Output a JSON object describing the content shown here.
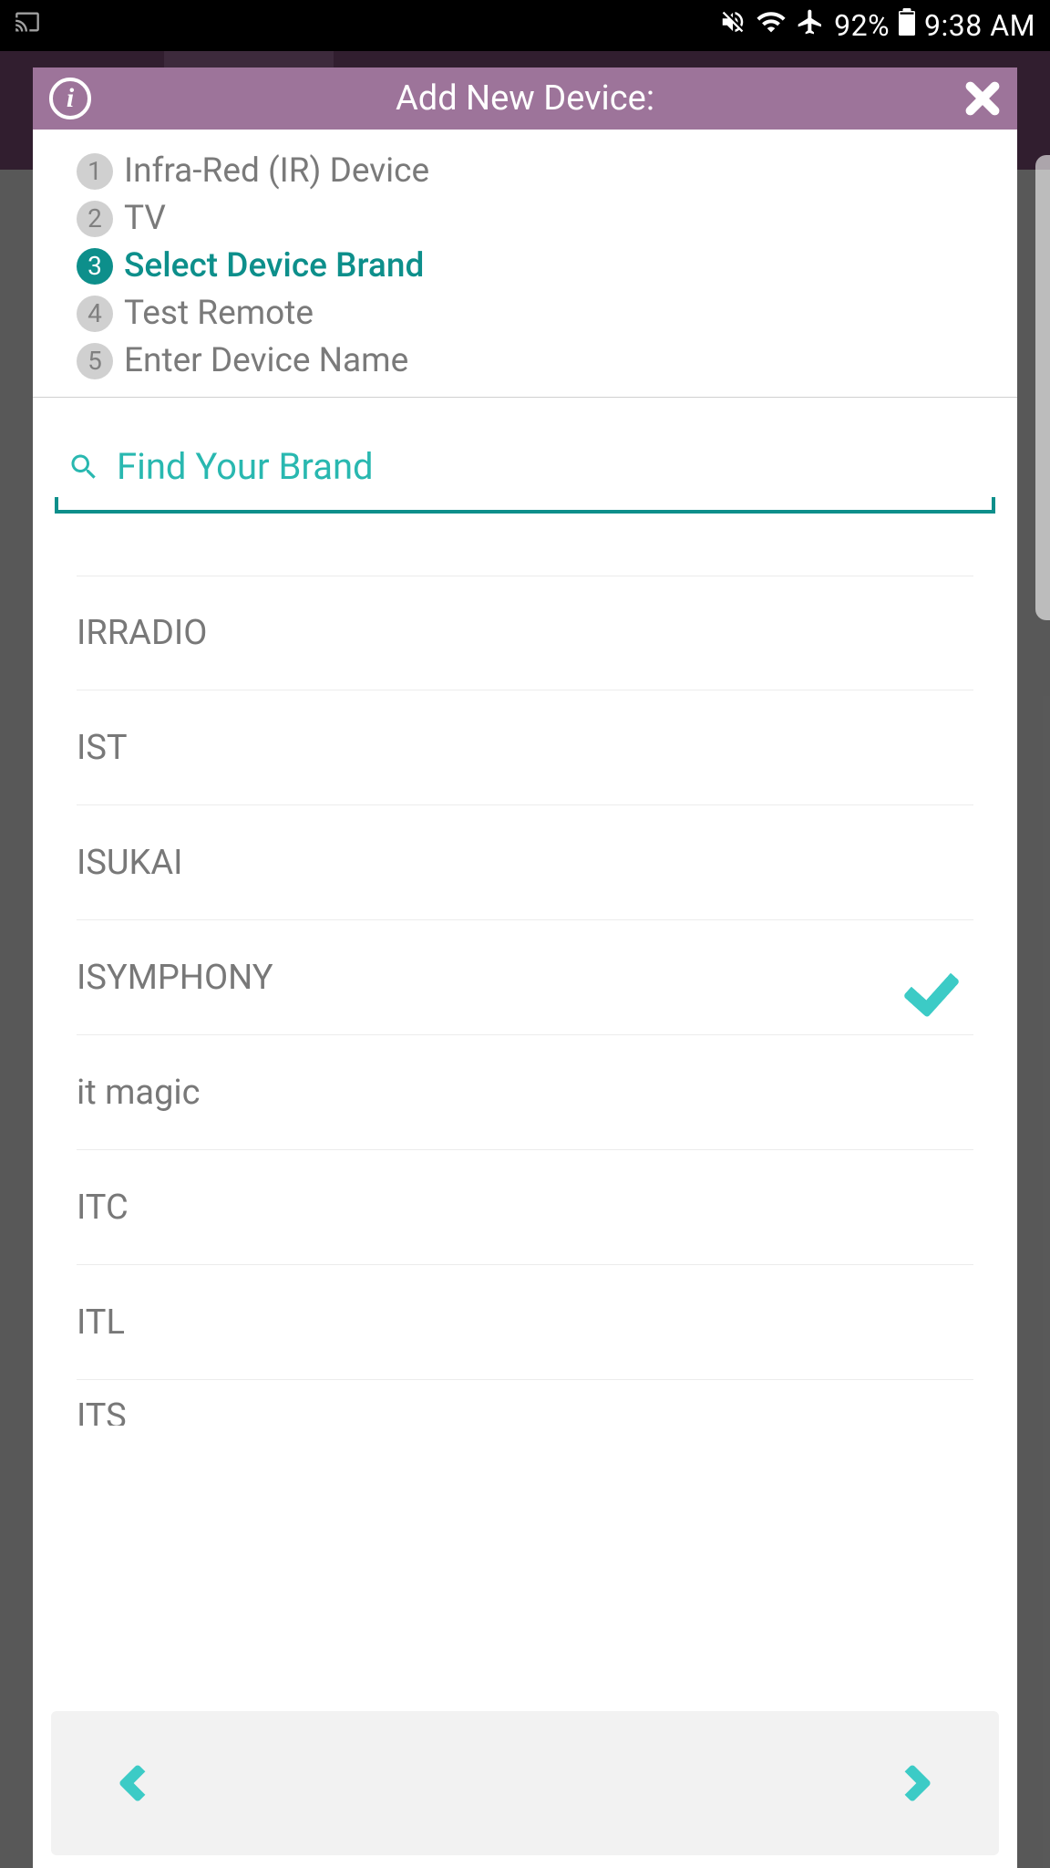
{
  "status_bar": {
    "battery_text": "92%",
    "time": "9:38 AM"
  },
  "dialog": {
    "title": "Add New Device:"
  },
  "steps": [
    {
      "num": "1",
      "label": "Infra-Red (IR) Device",
      "active": false
    },
    {
      "num": "2",
      "label": "TV",
      "active": false
    },
    {
      "num": "3",
      "label": "Select Device Brand",
      "active": true
    },
    {
      "num": "4",
      "label": "Test Remote",
      "active": false
    },
    {
      "num": "5",
      "label": "Enter Device Name",
      "active": false
    }
  ],
  "search": {
    "placeholder": "Find Your Brand"
  },
  "brands": [
    {
      "name": "IRRADIO",
      "selected": false
    },
    {
      "name": "IST",
      "selected": false
    },
    {
      "name": "ISUKAI",
      "selected": false
    },
    {
      "name": "ISYMPHONY",
      "selected": true
    },
    {
      "name": "it magic",
      "selected": false
    },
    {
      "name": "ITC",
      "selected": false
    },
    {
      "name": "ITL",
      "selected": false
    },
    {
      "name": "ITS",
      "selected": false,
      "partial": true
    }
  ]
}
